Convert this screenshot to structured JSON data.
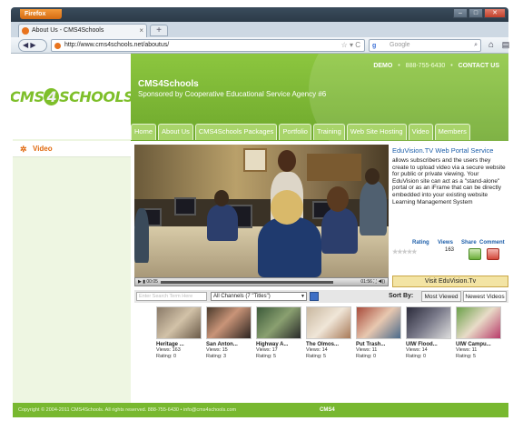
{
  "browser": {
    "firefox_button": "Firefox",
    "tab_title": "About Us - CMS4Schools",
    "new_tab": "+",
    "url": "http://www.cms4schools.net/aboutus/",
    "search_placeholder": "Google"
  },
  "header": {
    "links": [
      "DEMO",
      "888-755-6430",
      "CONTACT US"
    ],
    "title": "CMS4Schools",
    "subtitle": "Sponsored by Cooperative Educational Service Agency #6"
  },
  "logo": {
    "text_before": "CMS",
    "text_four": "4",
    "text_after": "SCHOOLS"
  },
  "menu": [
    "Home",
    "About Us",
    "CMS4Schools Packages",
    "Portfolio",
    "Training",
    "Web Site Hosting",
    "Video",
    "Members"
  ],
  "sidebar": {
    "video_label": "Video"
  },
  "player": {
    "time": "00:05",
    "duration": "01:56"
  },
  "side_info": {
    "title": "EduVision.TV Web Portal Service",
    "description": "allows subscribers and the users they create to upload video via a secure website for public or private viewing. Your EduVision site can act as a \"stand-alone\" portal or as an iFrame that can be directly embedded into your existing website Learning Management System",
    "labels": [
      "Rating",
      "Views",
      "Share",
      "Comment"
    ],
    "stars": "★★★★★",
    "views_value": "163",
    "visit_button": "Visit EduVision.Tv"
  },
  "filter": {
    "search_placeholder": "Enter Search Term Here",
    "channel_select": "All Channels (7 \"Titles\")",
    "sort_label": "Sort By:",
    "sort_options": [
      "Most Viewed",
      "Newest Videos"
    ]
  },
  "thumbnails": [
    {
      "title": "Heritage ...",
      "views": "Views: 163",
      "rating": "Rating: 0"
    },
    {
      "title": "San Anton...",
      "views": "Views: 15",
      "rating": "Rating: 3"
    },
    {
      "title": "Highway A...",
      "views": "Views: 17",
      "rating": "Rating: 5"
    },
    {
      "title": "The Olmos...",
      "views": "Views: 14",
      "rating": "Rating: 5"
    },
    {
      "title": "Put Trash...",
      "views": "Views: 11",
      "rating": "Rating: 0"
    },
    {
      "title": "UIW Flood...",
      "views": "Views: 14",
      "rating": "Rating: 0"
    },
    {
      "title": "UIW Campu...",
      "views": "Views: 11",
      "rating": "Rating: 5"
    }
  ],
  "footer": {
    "copyright": "Copyright © 2004-2011 CMS4Schools. All rights reserved.  888-755-6430  •  info@cms4schools.com",
    "mini_logo": "CMS4"
  },
  "colors": {
    "brand_green": "#8cc63f",
    "accent_orange": "#e0690f",
    "link_blue": "#1e5faa"
  }
}
